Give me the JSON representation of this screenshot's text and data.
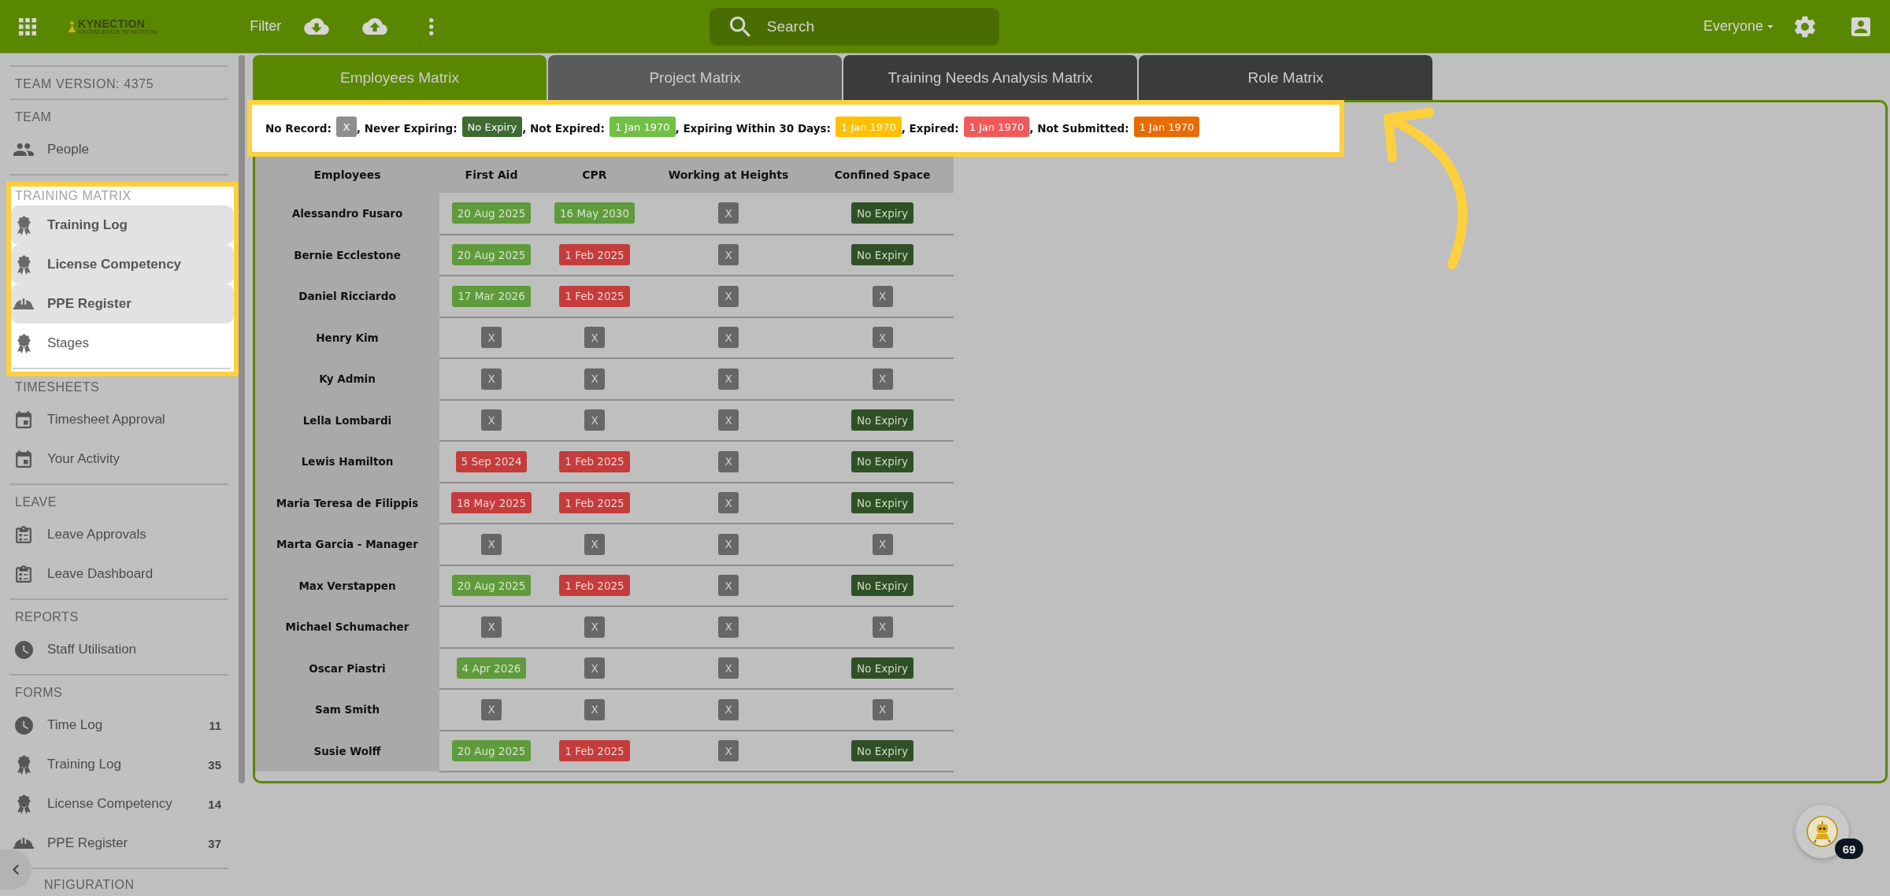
{
  "header": {
    "logo": {
      "name": "KYNECTION",
      "tagline": "KNOWLEDGE IN MOTION"
    },
    "filter_label": "Filter",
    "search": {
      "placeholder": "Search"
    },
    "audience": "Everyone"
  },
  "sidebar": {
    "version": "TEAM VERSION: 4375",
    "sections": [
      {
        "title": "TEAM",
        "spotlight": false,
        "items": [
          {
            "label": "People",
            "kind": "people"
          }
        ]
      },
      {
        "title": "TRAINING MATRIX",
        "spotlight": true,
        "items": [
          {
            "label": "Training Log",
            "kind": "award",
            "highlighted": true
          },
          {
            "label": "License Competency",
            "kind": "award",
            "highlighted": true
          },
          {
            "label": "PPE Register",
            "kind": "hard_hat",
            "highlighted": true
          },
          {
            "label": "Stages",
            "kind": "award",
            "highlighted": false
          }
        ]
      },
      {
        "title": "TIMESHEETS",
        "spotlight": false,
        "items": [
          {
            "label": "Timesheet Approval",
            "kind": "calendar"
          },
          {
            "label": "Your Activity",
            "kind": "calendar"
          }
        ]
      },
      {
        "title": "LEAVE",
        "spotlight": false,
        "items": [
          {
            "label": "Leave Approvals",
            "kind": "clipboard"
          },
          {
            "label": "Leave Dashboard",
            "kind": "clipboard"
          }
        ]
      },
      {
        "title": "REPORTS",
        "spotlight": false,
        "items": [
          {
            "label": "Staff Utilisation",
            "kind": "clock"
          }
        ]
      },
      {
        "title": "FORMS",
        "spotlight": false,
        "items": [
          {
            "label": "Time Log",
            "kind": "clock",
            "count": "11"
          },
          {
            "label": "Training Log",
            "kind": "award",
            "count": "35"
          },
          {
            "label": "License Competency",
            "kind": "award",
            "count": "14"
          },
          {
            "label": "PPE Register",
            "kind": "hard_hat",
            "count": "37"
          }
        ]
      }
    ],
    "cut_section_title": "NFIGURATION"
  },
  "tabs": [
    {
      "label": "Employees Matrix",
      "selected": true,
      "hovered": false
    },
    {
      "label": "Project Matrix",
      "selected": false,
      "hovered": true
    },
    {
      "label": "Training Needs Analysis Matrix",
      "selected": false,
      "hovered": false
    },
    {
      "label": "Role Matrix",
      "selected": false,
      "hovered": false
    }
  ],
  "legend": {
    "spotlight": true,
    "items": [
      {
        "label": "No Record:",
        "kind": "none",
        "sample": "X"
      },
      {
        "label": ", Never Expiring:",
        "kind": "no_expiry",
        "sample": "No Expiry"
      },
      {
        "label": ", Not Expired:",
        "kind": "valid",
        "sample": "1 Jan 1970"
      },
      {
        "label": ", Expiring Within 30 Days:",
        "kind": "expiring",
        "sample": "1 Jan 1970"
      },
      {
        "label": ", Expired:",
        "kind": "expired",
        "sample": "1 Jan 1970"
      },
      {
        "label": ", Not Submitted:",
        "kind": "not_submitted",
        "sample": "1 Jan 1970"
      }
    ]
  },
  "matrix": {
    "columns": [
      "Employees",
      "First Aid",
      "CPR",
      "Working at Heights",
      "Confined Space"
    ],
    "rows": [
      {
        "cells": [
          {
            "text": "Alessandro Fusaro",
            "kind": "employee"
          },
          {
            "text": "20 Aug 2025",
            "kind": "valid"
          },
          {
            "text": "16 May 2030",
            "kind": "valid"
          },
          {
            "text": "X",
            "kind": "none"
          },
          {
            "text": "No Expiry",
            "kind": "no_expiry"
          }
        ]
      },
      {
        "cells": [
          {
            "text": "Bernie Ecclestone",
            "kind": "employee"
          },
          {
            "text": "20 Aug 2025",
            "kind": "valid"
          },
          {
            "text": "1 Feb 2025",
            "kind": "expired"
          },
          {
            "text": "X",
            "kind": "none"
          },
          {
            "text": "No Expiry",
            "kind": "no_expiry"
          }
        ]
      },
      {
        "cells": [
          {
            "text": "Daniel Ricciardo",
            "kind": "employee"
          },
          {
            "text": "17 Mar 2026",
            "kind": "valid"
          },
          {
            "text": "1 Feb 2025",
            "kind": "expired"
          },
          {
            "text": "X",
            "kind": "none"
          },
          {
            "text": "X",
            "kind": "none"
          }
        ]
      },
      {
        "cells": [
          {
            "text": "Henry Kim",
            "kind": "employee"
          },
          {
            "text": "X",
            "kind": "none"
          },
          {
            "text": "X",
            "kind": "none"
          },
          {
            "text": "X",
            "kind": "none"
          },
          {
            "text": "X",
            "kind": "none"
          }
        ]
      },
      {
        "cells": [
          {
            "text": "Ky Admin",
            "kind": "employee"
          },
          {
            "text": "X",
            "kind": "none"
          },
          {
            "text": "X",
            "kind": "none"
          },
          {
            "text": "X",
            "kind": "none"
          },
          {
            "text": "X",
            "kind": "none"
          }
        ]
      },
      {
        "cells": [
          {
            "text": "Lella Lombardi",
            "kind": "employee"
          },
          {
            "text": "X",
            "kind": "none"
          },
          {
            "text": "X",
            "kind": "none"
          },
          {
            "text": "X",
            "kind": "none"
          },
          {
            "text": "No Expiry",
            "kind": "no_expiry"
          }
        ]
      },
      {
        "cells": [
          {
            "text": "Lewis Hamilton",
            "kind": "employee"
          },
          {
            "text": "5 Sep 2024",
            "kind": "expired"
          },
          {
            "text": "1 Feb 2025",
            "kind": "expired"
          },
          {
            "text": "X",
            "kind": "none"
          },
          {
            "text": "No Expiry",
            "kind": "no_expiry"
          }
        ]
      },
      {
        "cells": [
          {
            "text": "Maria Teresa de Filippis",
            "kind": "employee"
          },
          {
            "text": "18 May 2025",
            "kind": "expired"
          },
          {
            "text": "1 Feb 2025",
            "kind": "expired"
          },
          {
            "text": "X",
            "kind": "none"
          },
          {
            "text": "No Expiry",
            "kind": "no_expiry"
          }
        ]
      },
      {
        "cells": [
          {
            "text": "Marta Garcia - Manager",
            "kind": "employee"
          },
          {
            "text": "X",
            "kind": "none"
          },
          {
            "text": "X",
            "kind": "none"
          },
          {
            "text": "X",
            "kind": "none"
          },
          {
            "text": "X",
            "kind": "none"
          }
        ]
      },
      {
        "cells": [
          {
            "text": "Max Verstappen",
            "kind": "employee"
          },
          {
            "text": "20 Aug 2025",
            "kind": "valid"
          },
          {
            "text": "1 Feb 2025",
            "kind": "expired"
          },
          {
            "text": "X",
            "kind": "none"
          },
          {
            "text": "No Expiry",
            "kind": "no_expiry"
          }
        ]
      },
      {
        "cells": [
          {
            "text": "Michael Schumacher",
            "kind": "employee"
          },
          {
            "text": "X",
            "kind": "none"
          },
          {
            "text": "X",
            "kind": "none"
          },
          {
            "text": "X",
            "kind": "none"
          },
          {
            "text": "X",
            "kind": "none"
          }
        ]
      },
      {
        "cells": [
          {
            "text": "Oscar Piastri",
            "kind": "employee"
          },
          {
            "text": "4 Apr 2026",
            "kind": "valid"
          },
          {
            "text": "X",
            "kind": "none"
          },
          {
            "text": "X",
            "kind": "none"
          },
          {
            "text": "No Expiry",
            "kind": "no_expiry"
          }
        ]
      },
      {
        "cells": [
          {
            "text": "Sam Smith",
            "kind": "employee"
          },
          {
            "text": "X",
            "kind": "none"
          },
          {
            "text": "X",
            "kind": "none"
          },
          {
            "text": "X",
            "kind": "none"
          },
          {
            "text": "X",
            "kind": "none"
          }
        ]
      },
      {
        "cells": [
          {
            "text": "Susie Wolff",
            "kind": "employee"
          },
          {
            "text": "20 Aug 2025",
            "kind": "valid"
          },
          {
            "text": "1 Feb 2025",
            "kind": "expired"
          },
          {
            "text": "X",
            "kind": "none"
          },
          {
            "text": "No Expiry",
            "kind": "no_expiry"
          }
        ]
      }
    ]
  },
  "assistant": {
    "badge": "69"
  }
}
